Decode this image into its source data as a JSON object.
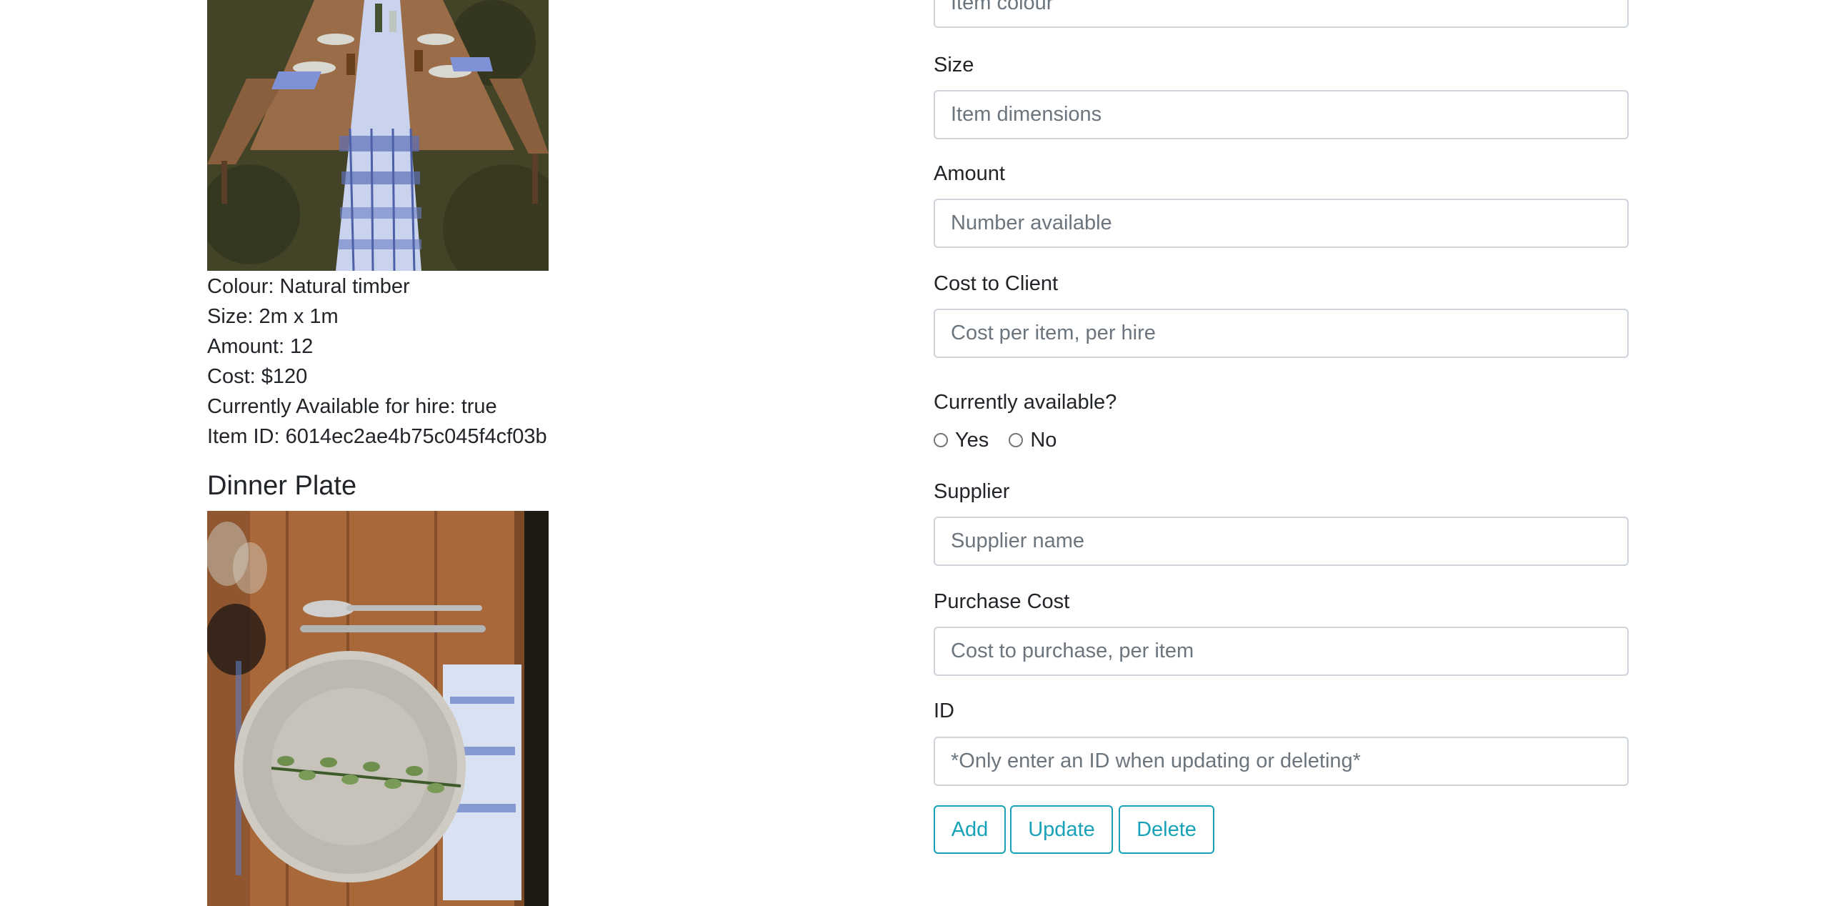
{
  "items": [
    {
      "details": {
        "colour": "Colour: Natural timber",
        "size": "Size: 2m x 1m",
        "amount": "Amount: 12",
        "cost": "Cost: $120",
        "available": "Currently Available for hire: true",
        "item_id": "Item ID: 6014ec2ae4b75c045f4cf03b"
      }
    },
    {
      "title": "Dinner Plate"
    }
  ],
  "form": {
    "colour": {
      "placeholder": "Item colour"
    },
    "size": {
      "label": "Size",
      "placeholder": "Item dimensions"
    },
    "amount": {
      "label": "Amount",
      "placeholder": "Number available"
    },
    "cost_client": {
      "label": "Cost to Client",
      "placeholder": "Cost per item, per hire"
    },
    "available": {
      "label": "Currently available?",
      "yes": "Yes",
      "no": "No"
    },
    "supplier": {
      "label": "Supplier",
      "placeholder": "Supplier name"
    },
    "purchase_cost": {
      "label": "Purchase Cost",
      "placeholder": "Cost to purchase, per item"
    },
    "id": {
      "label": "ID",
      "placeholder": "*Only enter an ID when updating or deleting*"
    },
    "buttons": {
      "add": "Add",
      "update": "Update",
      "delete": "Delete"
    }
  },
  "colors": {
    "accent": "#17a2b8",
    "input_border": "#ced4da",
    "text": "#212529",
    "placeholder": "#6c757d"
  }
}
